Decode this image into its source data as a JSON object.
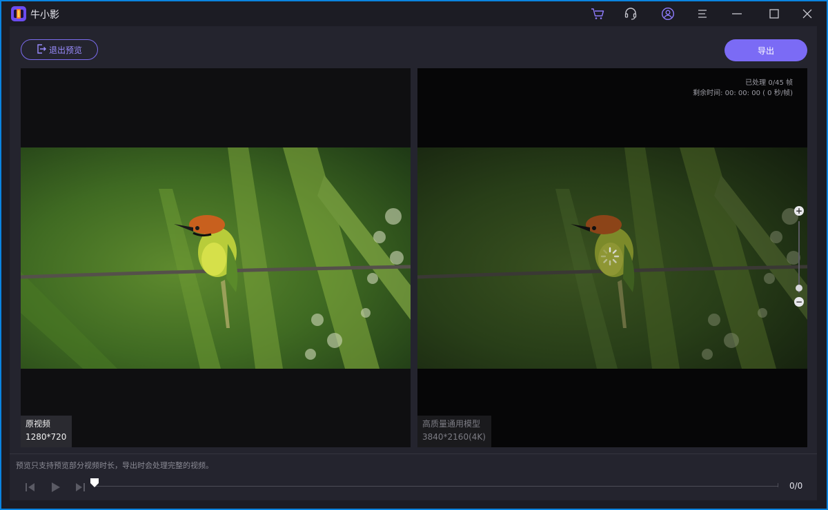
{
  "app": {
    "title": "牛小影"
  },
  "toolbar": {
    "exit_label": "退出预览",
    "export_label": "导出"
  },
  "left_pane": {
    "label": "原视频",
    "resolution": "1280*720"
  },
  "right_pane": {
    "processed": "已处理 0/45 帧",
    "remaining": "剩余时间: 00: 00: 00 ( 0 秒/帧)",
    "label": "高质量通用模型",
    "resolution": "3840*2160(4K)",
    "zoom_in": "+",
    "zoom_out": "−"
  },
  "bottom": {
    "hint": "预览只支持预览部分视频时长，导出时会处理完整的视频。",
    "frame_counter": "0/0"
  },
  "colors": {
    "accent": "#7b6bf5",
    "accent_text": "#9a8cff",
    "window_border": "#0a84e0"
  },
  "icons": [
    "cart-icon",
    "headset-icon",
    "user-icon",
    "menu-icon",
    "minimize-icon",
    "maximize-icon",
    "close-icon",
    "exit-icon",
    "prev-frame-icon",
    "play-icon",
    "next-frame-icon"
  ]
}
